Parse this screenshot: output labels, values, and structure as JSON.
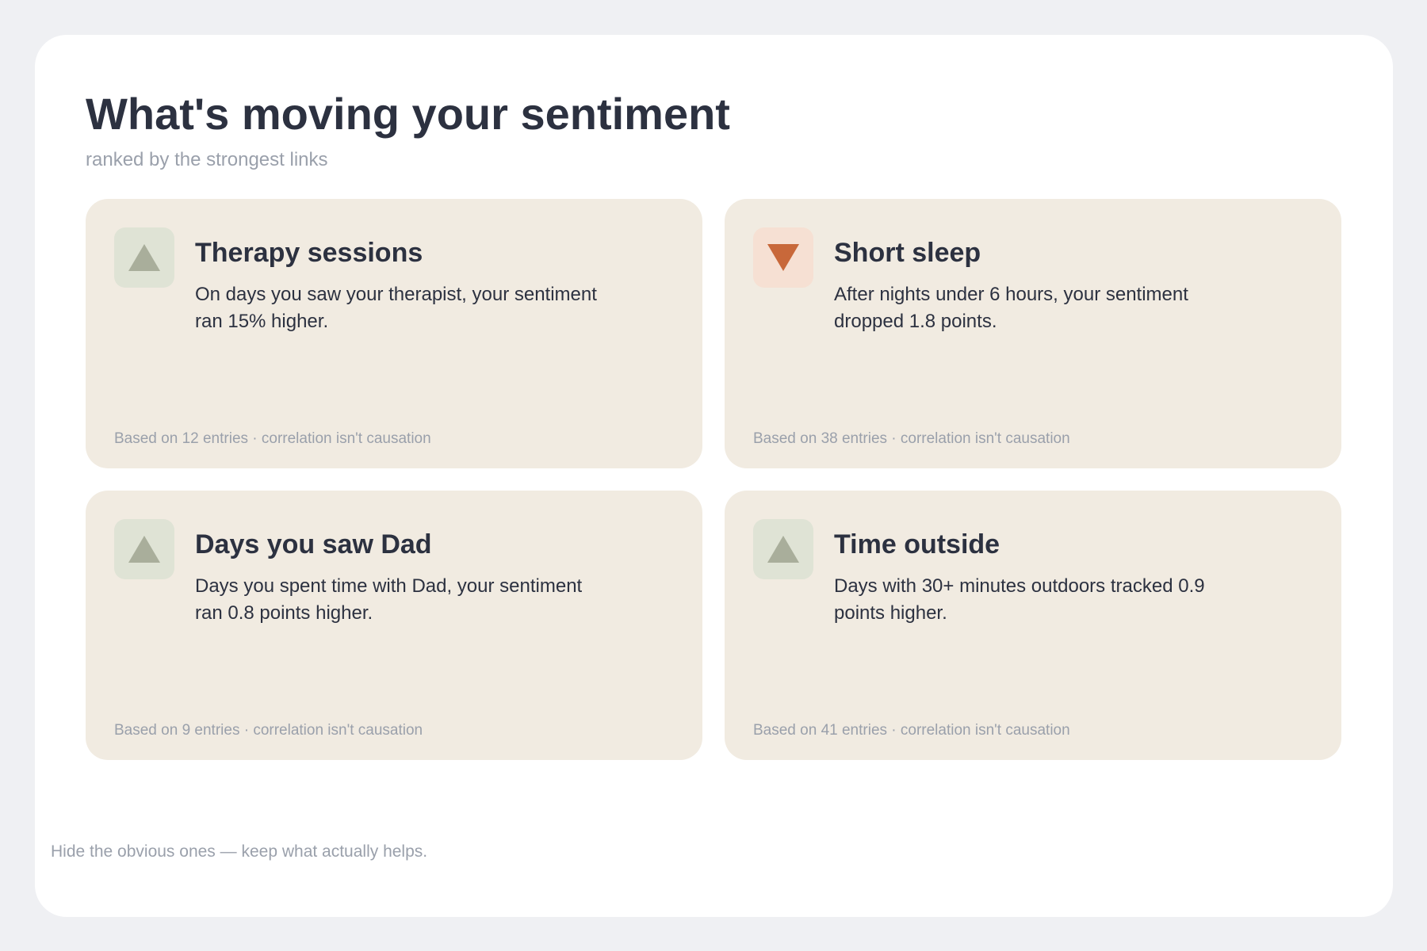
{
  "header": {
    "title": "What's moving your sentiment",
    "subtitle": "ranked by the strongest links"
  },
  "colors": {
    "up_icon": "#a9ae9b",
    "up_bg": "#dfe3d5",
    "down_icon": "#c8683a",
    "down_bg": "#f6e0d3",
    "card_bg": "#f1ebe1"
  },
  "cards": [
    {
      "direction": "up",
      "icon": "triangle-up-icon",
      "title": "Therapy sessions",
      "body": "On days you saw your therapist, your sentiment ran 15% higher.",
      "footnote": "Based on 12 entries · correlation isn't causation"
    },
    {
      "direction": "down",
      "icon": "triangle-down-icon",
      "title": "Short sleep",
      "body": "After nights under 6 hours, your sentiment dropped 1.8 points.",
      "footnote": "Based on 38 entries · correlation isn't causation"
    },
    {
      "direction": "up",
      "icon": "triangle-up-icon",
      "title": "Days you saw Dad",
      "body": "Days you spent time with Dad, your sentiment ran 0.8 points higher.",
      "footnote": "Based on 9 entries · correlation isn't causation"
    },
    {
      "direction": "up",
      "icon": "triangle-up-icon",
      "title": "Time outside",
      "body": "Days with 30+ minutes outdoors tracked 0.9 points higher.",
      "footnote": "Based on 41 entries · correlation isn't causation"
    }
  ],
  "footer": {
    "note": "Hide the obvious ones — keep what actually helps."
  }
}
